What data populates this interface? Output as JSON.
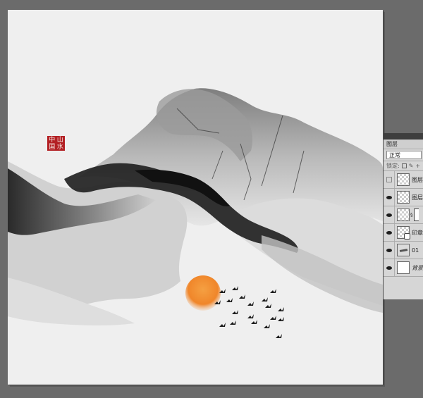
{
  "document": {
    "seal_chars": [
      "中",
      "山",
      "国",
      "水"
    ]
  },
  "layers_panel": {
    "tab_label": "图层",
    "blend_mode": "正常",
    "lock_label": "锁定:",
    "layers": [
      {
        "name": "图层",
        "visible": false,
        "thumb": "transparent"
      },
      {
        "name": "图层",
        "visible": true,
        "thumb": "transparent"
      },
      {
        "name": "",
        "visible": true,
        "thumb": "transparent",
        "has_mask": true
      },
      {
        "name": "印章",
        "visible": true,
        "thumb": "transparent",
        "has_fx": true
      },
      {
        "name": "01",
        "visible": true,
        "thumb": "image"
      },
      {
        "name": "背景",
        "visible": true,
        "thumb": "white",
        "italic": true
      }
    ]
  },
  "colors": {
    "workspace": "#6b6b6b",
    "canvas": "#efefef",
    "sun": "#f08a2c",
    "seal": "#b32024",
    "ink": "#1b1b1b"
  }
}
